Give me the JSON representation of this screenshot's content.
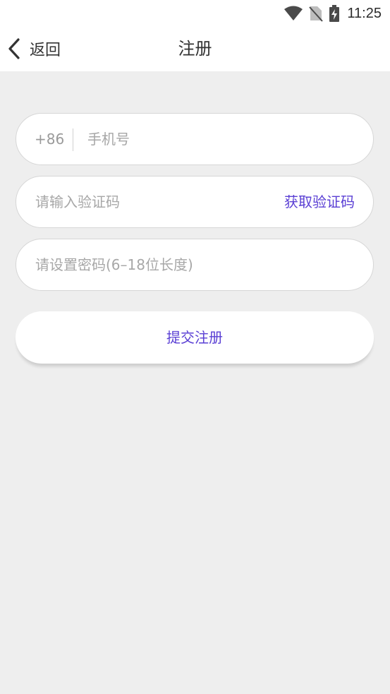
{
  "status_bar": {
    "time": "11:25",
    "icons": [
      "wifi-icon",
      "no-sim-icon",
      "battery-charging-icon"
    ]
  },
  "header": {
    "back_label": "返回",
    "title": "注册"
  },
  "form": {
    "phone": {
      "country_code": "+86",
      "placeholder": "手机号",
      "value": ""
    },
    "code": {
      "placeholder": "请输入验证码",
      "value": "",
      "get_code_label": "获取验证码"
    },
    "password": {
      "placeholder": "请设置密码(6–18位长度)",
      "value": ""
    },
    "submit_label": "提交注册"
  },
  "colors": {
    "accent": "#5a3fd4",
    "background": "#eeeeee",
    "surface": "#ffffff",
    "text": "#333333",
    "placeholder": "#a7a7a7"
  }
}
